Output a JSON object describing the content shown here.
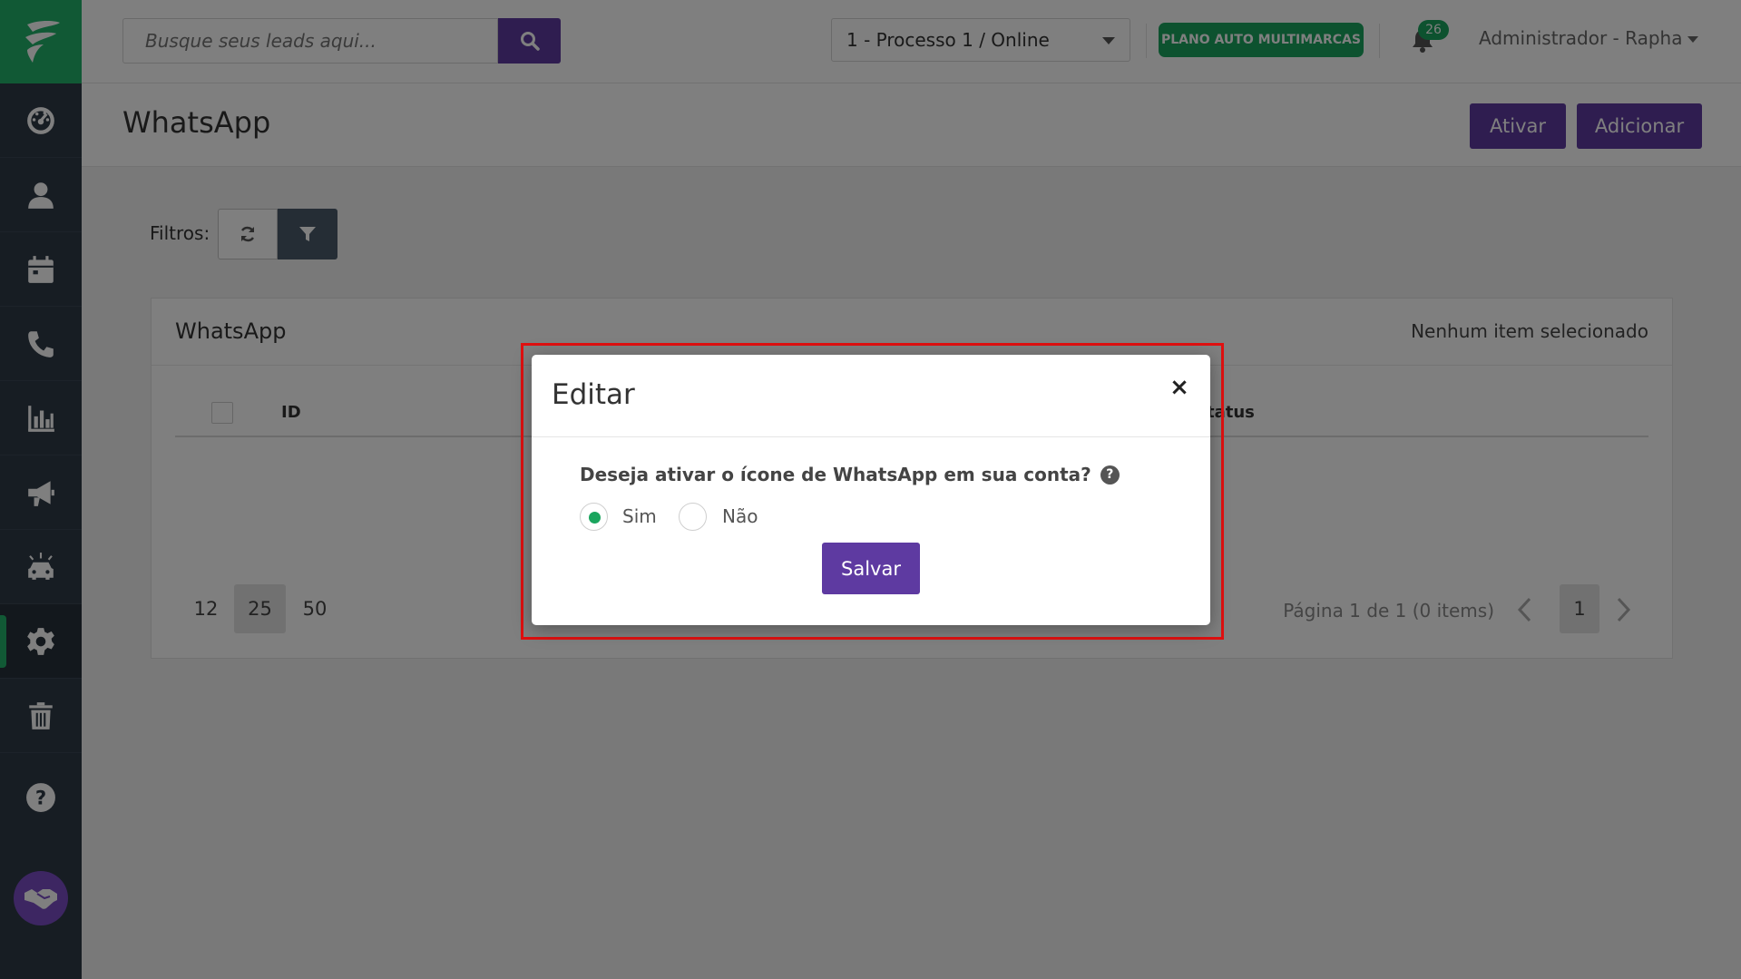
{
  "search": {
    "placeholder": "Busque seus leads aqui..."
  },
  "header": {
    "process": "1 - Processo 1 / Online",
    "plan": "PLANO AUTO MULTIMARCAS",
    "notifications": "26",
    "user": "Administrador - Rapha"
  },
  "page": {
    "title": "WhatsApp",
    "activate_label": "Ativar",
    "add_label": "Adicionar"
  },
  "filters": {
    "label": "Filtros:"
  },
  "panel": {
    "title": "WhatsApp",
    "selection": "Nenhum item selecionado",
    "columns": [
      "ID",
      "Status"
    ],
    "page_sizes": [
      "12",
      "25",
      "50"
    ],
    "active_page_size": "25",
    "page_info": "Página 1 de 1 (0 items)",
    "current_page": "1"
  },
  "modal": {
    "title": "Editar",
    "close": "×",
    "question": "Deseja ativar o ícone de WhatsApp em sua conta?",
    "help": "?",
    "options": [
      "Sim",
      "Não"
    ],
    "selected": "Sim",
    "save_label": "Salvar"
  },
  "colors": {
    "brand_green": "#22b36a",
    "primary_purple": "#5e3aa1",
    "sidebar": "#2f3a46",
    "highlight": "#e01010"
  },
  "icons": {
    "sidebar": [
      "dashboard-icon",
      "user-icon",
      "calendar-icon",
      "phone-icon",
      "chart-icon",
      "megaphone-icon",
      "car-alert-icon",
      "gear-icon",
      "trash-icon",
      "question-icon",
      "handshake-icon"
    ]
  }
}
